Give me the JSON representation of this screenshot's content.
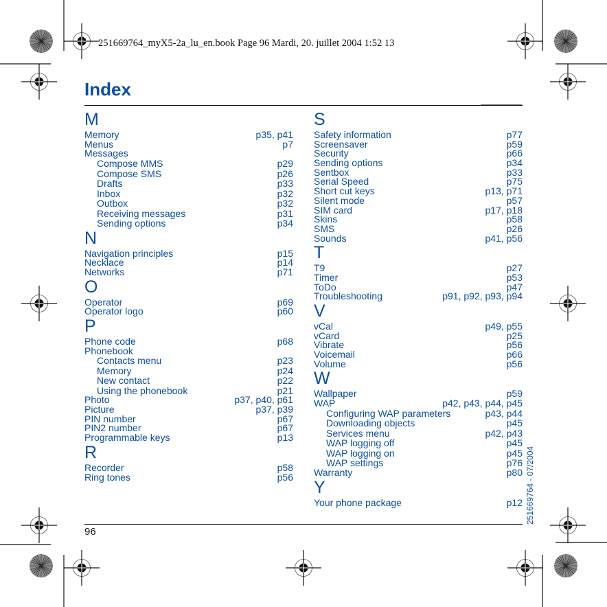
{
  "slug": "251669764_myX5-2a_lu_en.book  Page 96  Mardi, 20. juillet 2004  1:52 13",
  "title": "Index",
  "page_number": "96",
  "side_code": "251669764 - 07/2004",
  "colors": {
    "accent": "#0a4ea3",
    "text": "#111111"
  },
  "left_column": [
    {
      "letter": "M",
      "entries": [
        {
          "term": "Memory",
          "pages": "p35, p41"
        },
        {
          "term": "Menus",
          "pages": "p7"
        },
        {
          "term": "Messages",
          "pages": ""
        },
        {
          "term": "Compose MMS",
          "pages": "p29",
          "sub": true
        },
        {
          "term": "Compose SMS",
          "pages": "p26",
          "sub": true
        },
        {
          "term": "Drafts",
          "pages": "p33",
          "sub": true
        },
        {
          "term": "Inbox",
          "pages": "p32",
          "sub": true
        },
        {
          "term": "Outbox",
          "pages": "p32",
          "sub": true
        },
        {
          "term": "Receiving messages",
          "pages": "p31",
          "sub": true
        },
        {
          "term": "Sending options",
          "pages": "p34",
          "sub": true
        }
      ]
    },
    {
      "letter": "N",
      "entries": [
        {
          "term": "Navigation principles",
          "pages": "p15"
        },
        {
          "term": "Necklace",
          "pages": "p14"
        },
        {
          "term": "Networks",
          "pages": "p71"
        }
      ]
    },
    {
      "letter": "O",
      "entries": [
        {
          "term": "Operator",
          "pages": "p69"
        },
        {
          "term": "Operator logo",
          "pages": "p60"
        }
      ]
    },
    {
      "letter": "P",
      "entries": [
        {
          "term": "Phone code",
          "pages": "p68"
        },
        {
          "term": "Phonebook",
          "pages": ""
        },
        {
          "term": "Contacts menu",
          "pages": "p23",
          "sub": true
        },
        {
          "term": "Memory",
          "pages": "p24",
          "sub": true
        },
        {
          "term": "New contact",
          "pages": "p22",
          "sub": true
        },
        {
          "term": "Using the phonebook",
          "pages": "p21",
          "sub": true
        },
        {
          "term": "Photo",
          "pages": "p37, p40, p61"
        },
        {
          "term": "Picture",
          "pages": "p37, p39"
        },
        {
          "term": "PIN number",
          "pages": "p67"
        },
        {
          "term": "PIN2 number",
          "pages": "p67"
        },
        {
          "term": "Programmable keys",
          "pages": "p13"
        }
      ]
    },
    {
      "letter": "R",
      "entries": [
        {
          "term": "Recorder",
          "pages": "p58"
        },
        {
          "term": "Ring tones",
          "pages": "p56"
        }
      ]
    }
  ],
  "right_column": [
    {
      "letter": "S",
      "entries": [
        {
          "term": "Safety information",
          "pages": "p77"
        },
        {
          "term": "Screensaver",
          "pages": "p59"
        },
        {
          "term": "Security",
          "pages": "p66"
        },
        {
          "term": "Sending options",
          "pages": "p34"
        },
        {
          "term": "Sentbox",
          "pages": "p33"
        },
        {
          "term": "Serial Speed",
          "pages": "p75"
        },
        {
          "term": "Short cut keys",
          "pages": "p13, p71"
        },
        {
          "term": "Silent mode",
          "pages": "p57"
        },
        {
          "term": "SIM card",
          "pages": "p17, p18"
        },
        {
          "term": "Skins",
          "pages": "p58"
        },
        {
          "term": "SMS",
          "pages": "p26"
        },
        {
          "term": "Sounds",
          "pages": "p41, p56"
        }
      ]
    },
    {
      "letter": "T",
      "entries": [
        {
          "term": "T9",
          "pages": "p27"
        },
        {
          "term": "Timer",
          "pages": "p53"
        },
        {
          "term": "ToDo",
          "pages": "p47"
        },
        {
          "term": "Troubleshooting",
          "pages": "p91, p92, p93, p94"
        }
      ]
    },
    {
      "letter": "V",
      "entries": [
        {
          "term": "vCal",
          "pages": "p49, p55"
        },
        {
          "term": "vCard",
          "pages": "p25"
        },
        {
          "term": "Vibrate",
          "pages": "p56"
        },
        {
          "term": "Voicemail",
          "pages": "p66"
        },
        {
          "term": "Volume",
          "pages": "p56"
        }
      ]
    },
    {
      "letter": "W",
      "entries": [
        {
          "term": "Wallpaper",
          "pages": "p59"
        },
        {
          "term": "WAP",
          "pages": "p42, p43, p44, p45"
        },
        {
          "term": "Configuring WAP parameters",
          "pages": "p43, p44",
          "sub": true
        },
        {
          "term": "Downloading objects",
          "pages": "p45",
          "sub": true
        },
        {
          "term": "Services menu",
          "pages": "p42, p43",
          "sub": true
        },
        {
          "term": "WAP logging off",
          "pages": "p45",
          "sub": true
        },
        {
          "term": "WAP logging on",
          "pages": "p45",
          "sub": true
        },
        {
          "term": "WAP settings",
          "pages": "p76",
          "sub": true
        },
        {
          "term": "Warranty",
          "pages": "p80"
        }
      ]
    },
    {
      "letter": "Y",
      "entries": [
        {
          "term": "Your phone package",
          "pages": "p12"
        }
      ]
    }
  ]
}
